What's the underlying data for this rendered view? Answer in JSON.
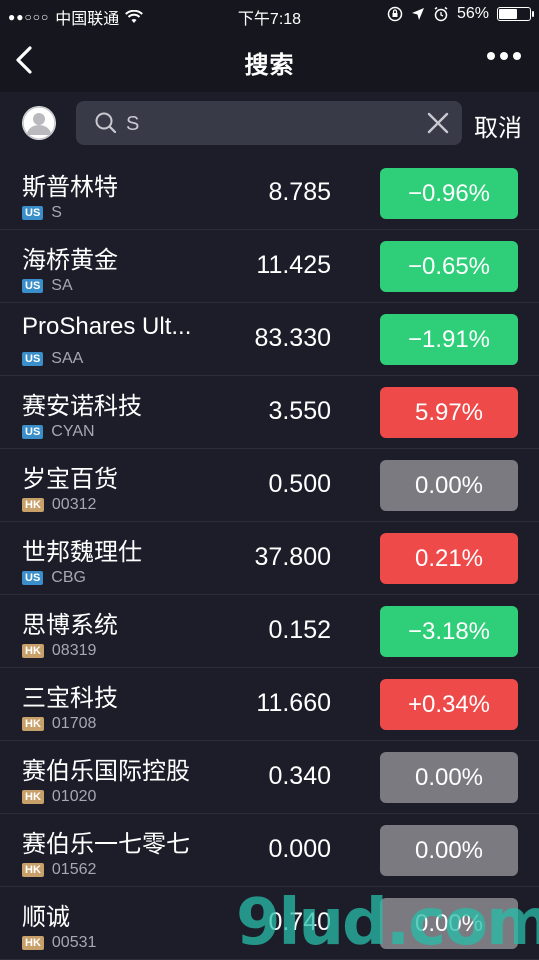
{
  "status_bar": {
    "signal": "●●○○○",
    "carrier": "中国联通",
    "time": "下午7:18",
    "battery": "56%"
  },
  "nav": {
    "title": "搜索"
  },
  "search": {
    "value": "S",
    "cancel_label": "取消"
  },
  "colors": {
    "down": "#2fcf7a",
    "up": "#ee4a4a",
    "flat": "#7a7a80",
    "us_badge": "#3a8ec9",
    "hk_badge": "#c8a06a"
  },
  "results": [
    {
      "name": "斯普林特",
      "market": "US",
      "symbol": "S",
      "price": "8.785",
      "change": "−0.96%",
      "trend": "down"
    },
    {
      "name": "海桥黄金",
      "market": "US",
      "symbol": "SA",
      "price": "11.425",
      "change": "−0.65%",
      "trend": "down"
    },
    {
      "name": "ProShares Ult...",
      "market": "US",
      "symbol": "SAA",
      "price": "83.330",
      "change": "−1.91%",
      "trend": "down"
    },
    {
      "name": "赛安诺科技",
      "market": "US",
      "symbol": "CYAN",
      "price": "3.550",
      "change": "5.97%",
      "trend": "up"
    },
    {
      "name": "岁宝百货",
      "market": "HK",
      "symbol": "00312",
      "price": "0.500",
      "change": "0.00%",
      "trend": "flat"
    },
    {
      "name": "世邦魏理仕",
      "market": "US",
      "symbol": "CBG",
      "price": "37.800",
      "change": "0.21%",
      "trend": "up"
    },
    {
      "name": "思博系统",
      "market": "HK",
      "symbol": "08319",
      "price": "0.152",
      "change": "−3.18%",
      "trend": "down"
    },
    {
      "name": "三宝科技",
      "market": "HK",
      "symbol": "01708",
      "price": "11.660",
      "change": "+0.34%",
      "trend": "up"
    },
    {
      "name": "赛伯乐国际控股",
      "market": "HK",
      "symbol": "01020",
      "price": "0.340",
      "change": "0.00%",
      "trend": "flat"
    },
    {
      "name": "赛伯乐一七零七",
      "market": "HK",
      "symbol": "01562",
      "price": "0.000",
      "change": "0.00%",
      "trend": "flat"
    },
    {
      "name": "顺诚",
      "market": "HK",
      "symbol": "00531",
      "price": "0.740",
      "change": "0.00%",
      "trend": "flat"
    }
  ],
  "watermark": "9lud.com"
}
